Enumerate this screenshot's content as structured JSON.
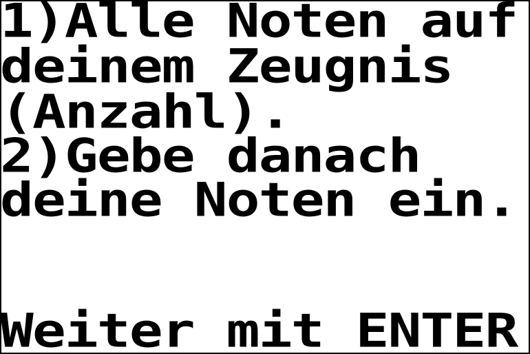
{
  "screen": {
    "lines": [
      "1)Alle Noten auf",
      "deinem Zeugnis",
      "(Anzahl).",
      "2)Gebe danach",
      "deine Noten ein.",
      "",
      "Weiter mit ENTER"
    ]
  },
  "colors": {
    "foreground": "#000000",
    "background": "#ffffff"
  }
}
